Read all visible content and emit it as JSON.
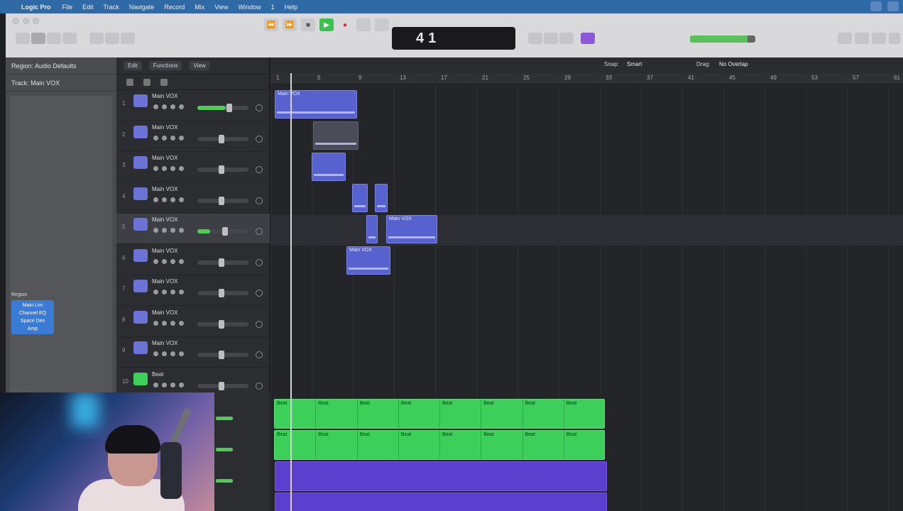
{
  "menubar": {
    "app": "Logic Pro",
    "items": [
      "File",
      "Edit",
      "Track",
      "Navigate",
      "Record",
      "Mix",
      "View",
      "Window",
      "1",
      "Help"
    ]
  },
  "window": {
    "title": ""
  },
  "transport": {
    "position_bar": "4",
    "position_beat": "1",
    "tempo": "",
    "key": "",
    "signature": ""
  },
  "inspector": {
    "region_label": "Region: Audio Defaults",
    "track_label": "Track: Main VOX"
  },
  "tracks_toolbar": {
    "edit": "Edit",
    "functions": "Functions",
    "view": "View"
  },
  "arrange_toolbar": {
    "snap_label": "Snap:",
    "snap_value": "Smart",
    "drag_label": "Drag:",
    "drag_value": "No Overlap"
  },
  "tracks": [
    {
      "num": "1",
      "name": "Main VOX",
      "icon": "waveform-icon",
      "level": 0.55,
      "selected": false
    },
    {
      "num": "2",
      "name": "Main VOX",
      "icon": "waveform-icon",
      "level": 0.0,
      "selected": false
    },
    {
      "num": "3",
      "name": "Main VOX",
      "icon": "waveform-icon",
      "level": 0.0,
      "selected": false
    },
    {
      "num": "4",
      "name": "Main VOX",
      "icon": "waveform-icon",
      "level": 0.0,
      "selected": false
    },
    {
      "num": "5",
      "name": "Main VOX",
      "icon": "waveform-icon",
      "level": 0.25,
      "selected": true
    },
    {
      "num": "6",
      "name": "Main VOX",
      "icon": "waveform-icon",
      "level": 0.0,
      "selected": false
    },
    {
      "num": "7",
      "name": "Main VOX",
      "icon": "waveform-icon",
      "level": 0.0,
      "selected": false
    },
    {
      "num": "8",
      "name": "Main VOX",
      "icon": "waveform-icon",
      "level": 0.0,
      "selected": false
    },
    {
      "num": "9",
      "name": "Main VOX",
      "icon": "waveform-icon",
      "level": 0.0,
      "selected": false
    },
    {
      "num": "10",
      "name": "Beat",
      "icon": "drum-icon",
      "level": 0.0,
      "selected": false
    }
  ],
  "ruler": [
    "1",
    "5",
    "9",
    "13",
    "17",
    "21",
    "25",
    "29",
    "33",
    "37",
    "41",
    "45",
    "49",
    "53",
    "57",
    "61"
  ],
  "regions": {
    "r1": "Main VOX",
    "r2": "",
    "r3": "",
    "r4": "",
    "r5": "",
    "r6": "",
    "r7": "Main VOX",
    "r8": "Main VOX"
  },
  "green_regions": {
    "row1": [
      "Beat",
      "Beat",
      "Beat",
      "Beat",
      "Beat",
      "Beat",
      "Beat",
      "Beat"
    ],
    "row2": [
      "Beat",
      "Beat",
      "Beat",
      "Beat",
      "Beat",
      "Beat",
      "Beat",
      "Beat"
    ]
  },
  "channel_strip": {
    "label": "Region",
    "plugins": [
      "Main Lim",
      "Channel EQ",
      "Space Des",
      "Amp"
    ]
  },
  "colors": {
    "region_blue": "#5862cf",
    "region_green": "#3ccf5a",
    "region_violet": "#5b3fcf",
    "play_green": "#3bc150",
    "record_red": "#e02828"
  }
}
